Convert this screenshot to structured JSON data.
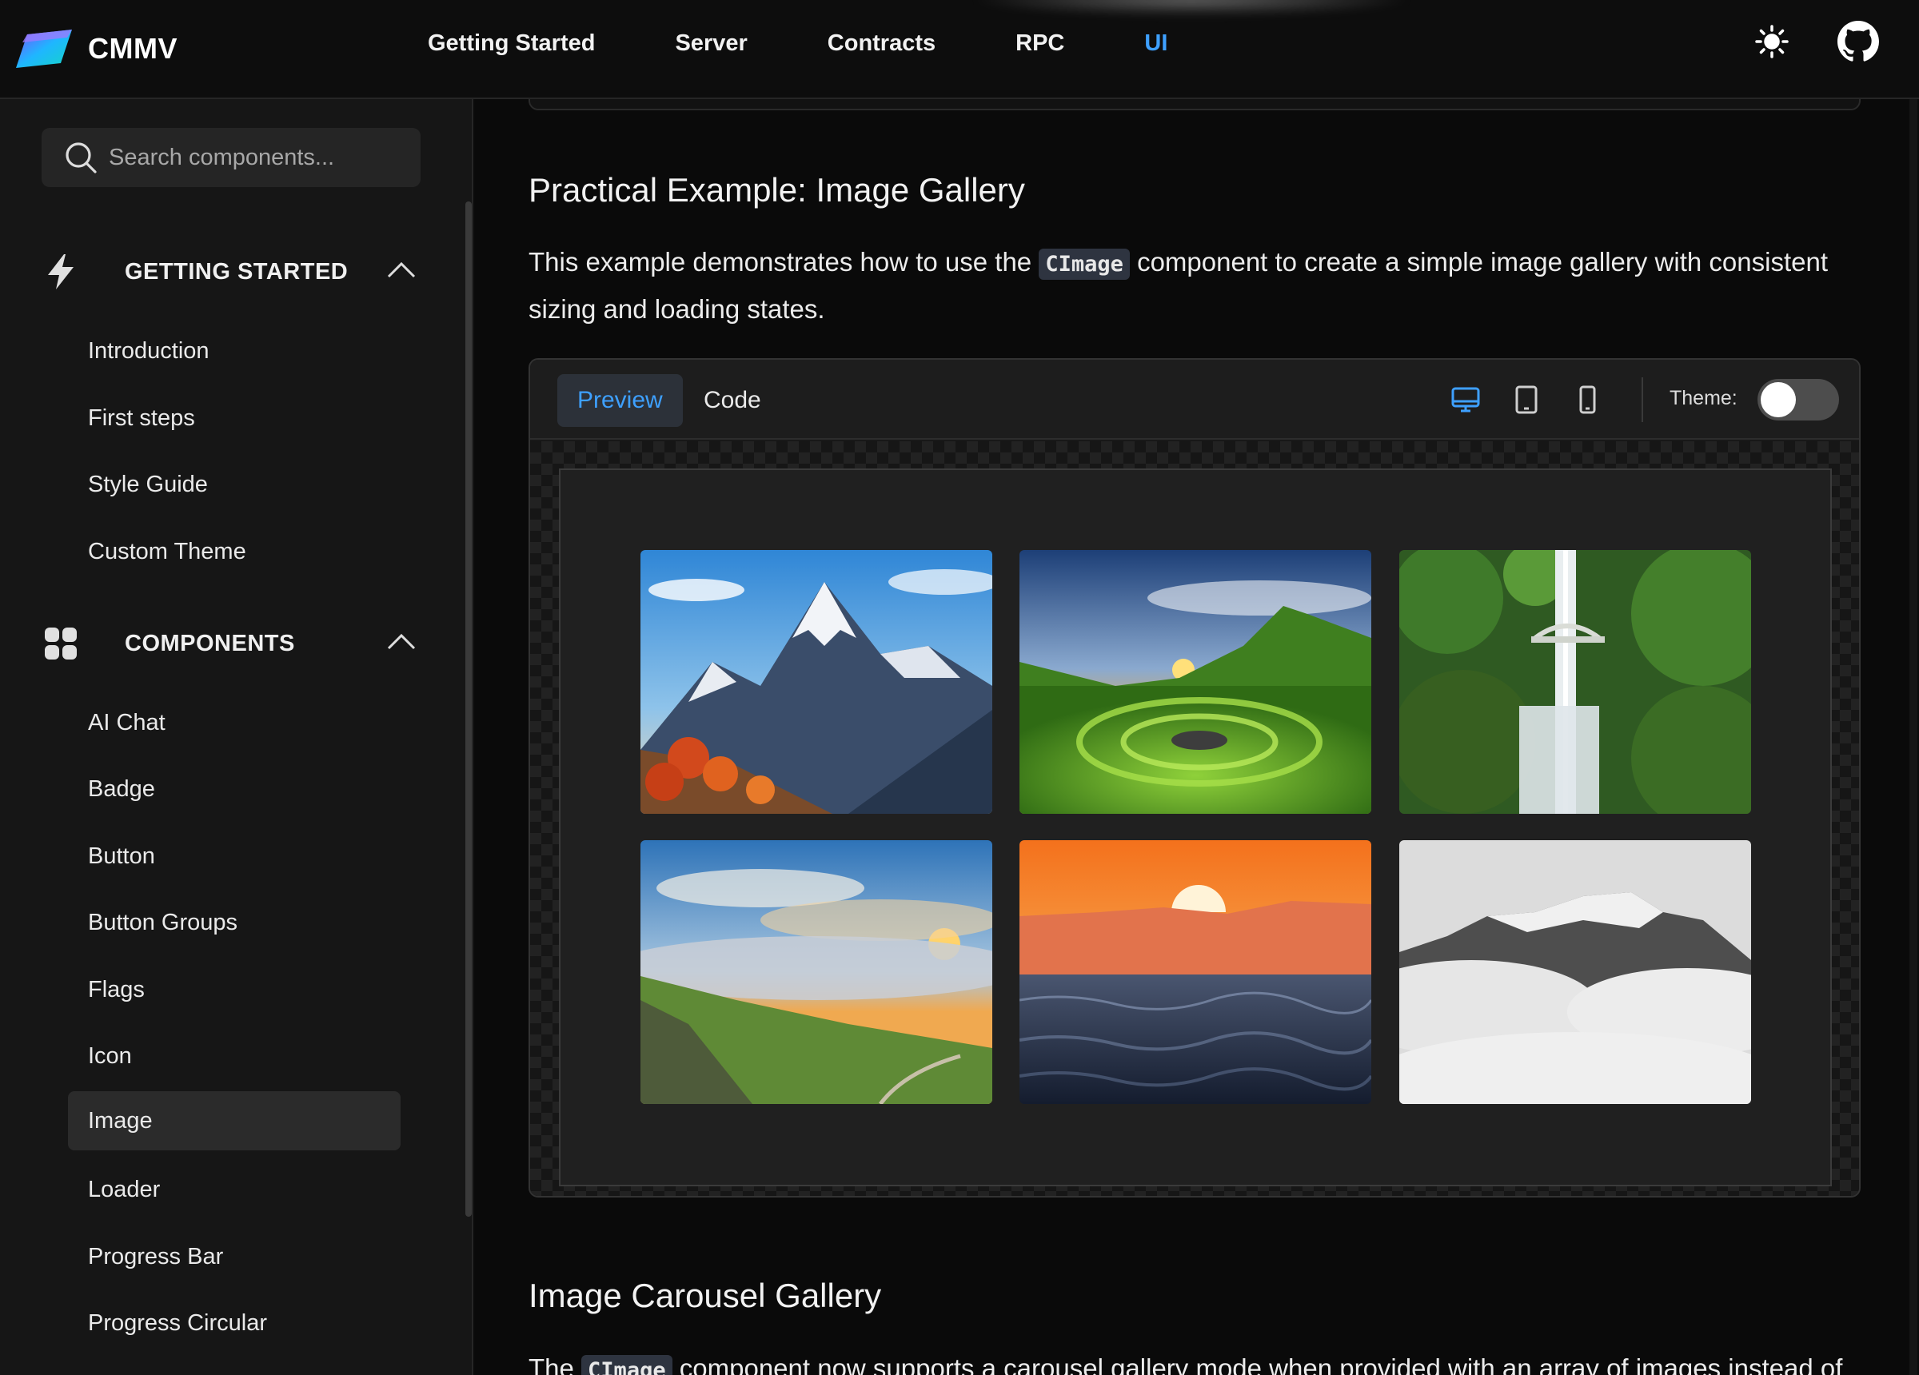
{
  "brand": {
    "name": "CMMV"
  },
  "nav": {
    "items": [
      {
        "label": "Getting Started"
      },
      {
        "label": "Server"
      },
      {
        "label": "Contracts"
      },
      {
        "label": "RPC"
      },
      {
        "label": "UI"
      }
    ],
    "active": "UI"
  },
  "icons": {
    "theme": "sun-icon",
    "repo": "github-icon"
  },
  "sidebar": {
    "search_placeholder": "Search components...",
    "sections": [
      {
        "label": "GETTING STARTED",
        "icon": "bolt-icon",
        "items": [
          "Introduction",
          "First steps",
          "Style Guide",
          "Custom Theme"
        ]
      },
      {
        "label": "COMPONENTS",
        "icon": "grid-icon",
        "items": [
          "AI Chat",
          "Badge",
          "Button",
          "Button Groups",
          "Flags",
          "Icon",
          "Image",
          "Loader",
          "Progress Bar",
          "Progress Circular"
        ]
      }
    ],
    "active_item": "Image"
  },
  "main": {
    "section1": {
      "title": "Practical Example: Image Gallery",
      "text_before": "This example demonstrates how to use the",
      "code": "CImage",
      "text_after": "component to create a simple image gallery with consistent sizing and loading states."
    },
    "demo": {
      "tabs": [
        "Preview",
        "Code"
      ],
      "active_tab": "Preview",
      "devices": [
        "desktop-icon",
        "tablet-icon",
        "mobile-icon"
      ],
      "active_device": "desktop-icon",
      "theme_label": "Theme:",
      "theme_dark": false,
      "images": [
        "mountain-peak",
        "green-valley-sunset",
        "waterfall-bridge",
        "misty-hills-sunset",
        "ocean-sunset",
        "foggy-mountain"
      ]
    },
    "section2": {
      "title": "Image Carousel Gallery",
      "text_before": "The",
      "code": "CImage",
      "text_after": "component now supports a carousel gallery mode when provided with an array of images instead of"
    }
  },
  "colors": {
    "accent": "#3ea0ff",
    "background": "#0b0b0b",
    "sidebar": "#161616"
  }
}
